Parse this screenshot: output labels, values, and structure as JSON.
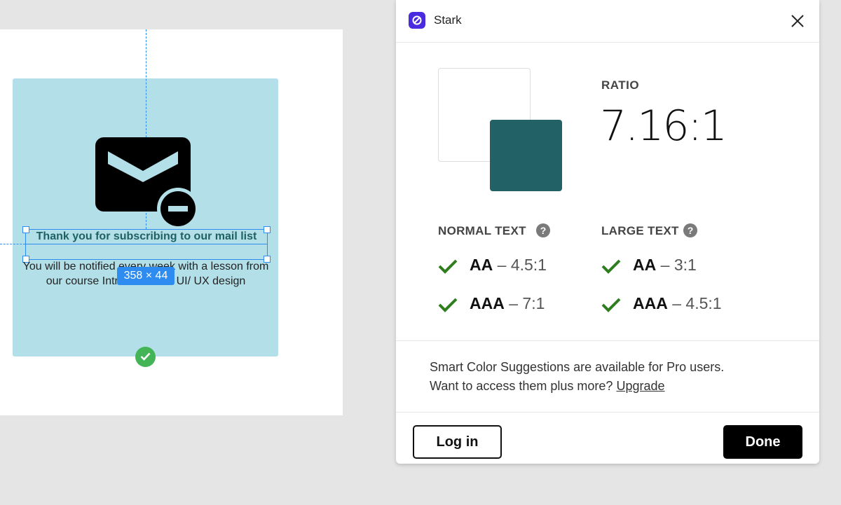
{
  "canvas": {
    "heading": "Thank you for subscribing to our mail list",
    "body": "You will be notified every week with a lesson from our course Introduction to UI/ UX design",
    "size_badge": "358 × 44",
    "card_color": "#b3e0e8",
    "icons": [
      "mail-remove-icon",
      "check-icon"
    ]
  },
  "panel": {
    "title": "Stark",
    "close_icon": "close-icon",
    "ratio_label": "RATIO",
    "ratio_value": "7.16:1",
    "foreground_color": "#ffffff",
    "background_color": "#226166",
    "normal": {
      "title": "NORMAL TEXT",
      "aa_level": "AA",
      "aa_threshold": "4.5:1",
      "aaa_level": "AAA",
      "aaa_threshold": "7:1"
    },
    "large": {
      "title": "LARGE TEXT",
      "aa_level": "AA",
      "aa_threshold": "3:1",
      "aaa_level": "AAA",
      "aaa_threshold": "4.5:1"
    },
    "dash": "–",
    "help_glyph": "?",
    "pro_line1": "Smart Color Suggestions are available for Pro users.",
    "pro_line2": "Want to access them plus more?",
    "upgrade_link": "Upgrade",
    "login_label": "Log in",
    "done_label": "Done",
    "pass_color": "#2e7d1e"
  }
}
